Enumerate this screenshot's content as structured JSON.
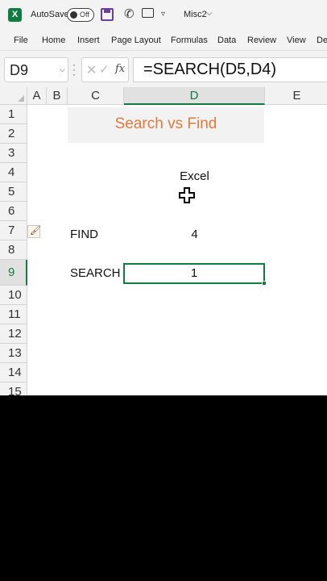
{
  "titlebar": {
    "app_icon": "X",
    "autosave_label": "AutoSave",
    "autosave_state": "Off",
    "doc_title": "Misc2",
    "icons": [
      "excel-logo-icon",
      "save-icon",
      "phone-icon",
      "share-icon",
      "dropdown-icon",
      "chevron-down-icon"
    ]
  },
  "ribbon": {
    "tabs": [
      "File",
      "Home",
      "Insert",
      "Page Layout",
      "Formulas",
      "Data",
      "Review",
      "View",
      "De"
    ]
  },
  "formula_bar": {
    "namebox": "D9",
    "formula": "=SEARCH(D5,D4)",
    "fx_label": "fx",
    "cancel_glyph": "✕",
    "enter_glyph": "✓"
  },
  "grid": {
    "columns": [
      "A",
      "B",
      "C",
      "D",
      "E"
    ],
    "selected_column": "D",
    "rows": [
      "1",
      "2",
      "3",
      "4",
      "5",
      "6",
      "7",
      "8",
      "9",
      "10",
      "11",
      "12",
      "13",
      "14",
      "15"
    ],
    "selected_row": "9",
    "title": "Search vs Find",
    "d4": "Excel",
    "c7": "FIND",
    "d7": "4",
    "c9": "SEARCH",
    "d9": "1",
    "title_color": "#e07a3c",
    "accent_color": "#107c41"
  }
}
